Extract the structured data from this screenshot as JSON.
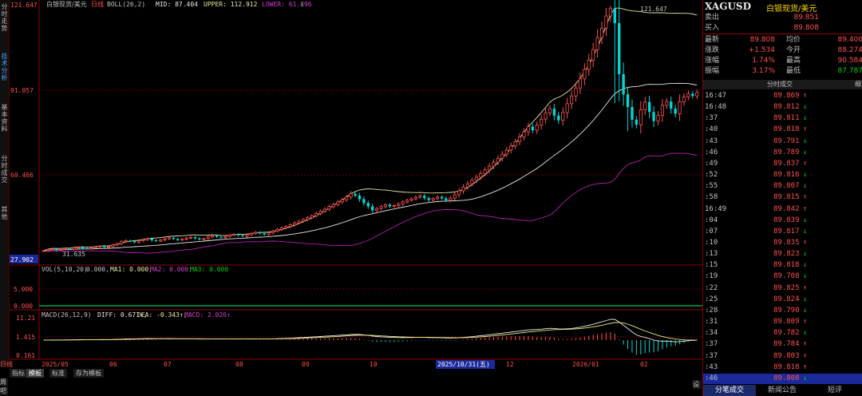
{
  "side_tabs": [
    "分时走势",
    "技术分析",
    "基本资料",
    "分时成交",
    "其他"
  ],
  "indicator_bars": {
    "main": {
      "title": "白银现货/美元",
      "period": "日线",
      "formula": "BOLL(26,2)",
      "mid": "MID: 87.404",
      "upper": "UPPER: 112.912",
      "lower": "LOWER: 61.896",
      "arrow": "↓"
    },
    "vol": {
      "name": "VOL(5,10,20)",
      "value": "0.000,",
      "ma1": "MA1: 0.000,",
      "ma2": "MA2: 0.000,",
      "ma3": "MA3: 0.000"
    },
    "macd": {
      "name": "MACD(26,12,9)",
      "diff": "DIFF: 0.671↑,",
      "dea": "DEA: -0.343↑,",
      "macd": "MACD: 2.026↑"
    }
  },
  "axis_labels": {
    "price_top": "121.647",
    "price_mid": "91.057",
    "price_low": "60.466",
    "price_bottom": "27.902",
    "vol_mid": "5.000",
    "vol_bottom": "0.000",
    "macd_top": "11.21",
    "macd_mid": "1.415",
    "macd_bottom": "0.161"
  },
  "chart_data": {
    "type": "candlestick",
    "title": "白银现货/美元 日线",
    "x_tick_labels": [
      "2025/05",
      "06",
      "07",
      "08",
      "09",
      "10",
      "2025/10/31(五)",
      "12",
      "2026/01",
      "02"
    ],
    "annotations": {
      "high": "121.647",
      "low": "31.635"
    },
    "y_axis": {
      "min": 27.902,
      "max": 121.647,
      "ticks": [
        121.647,
        91.057,
        60.466,
        27.902
      ]
    },
    "indicator": "BOLL(26,2)",
    "last_values": {
      "mid": 87.404,
      "upper": 112.912,
      "lower": 61.896
    },
    "close_series": [
      32.5,
      32.9,
      33.2,
      32.8,
      33.0,
      33.3,
      33.1,
      33.6,
      33.8,
      33.4,
      33.2,
      33.5,
      33.9,
      34.2,
      33.8,
      34.0,
      34.6,
      35.1,
      35.8,
      36.2,
      36.0,
      35.6,
      36.1,
      36.5,
      36.9,
      36.3,
      36.0,
      36.4,
      36.8,
      37.2,
      36.8,
      36.4,
      36.7,
      37.1,
      37.4,
      37.0,
      36.6,
      36.9,
      37.5,
      38.0,
      37.6,
      37.3,
      37.7,
      38.2,
      38.5,
      38.1,
      37.8,
      38.3,
      38.8,
      39.2,
      38.8,
      38.4,
      39.0,
      39.6,
      40.2,
      40.8,
      41.3,
      41.9,
      42.6,
      43.2,
      43.8,
      44.5,
      45.2,
      46.0,
      46.8,
      47.6,
      48.5,
      49.3,
      50.2,
      51.0,
      52.0,
      53.2,
      52.5,
      51.2,
      49.8,
      48.6,
      47.2,
      47.8,
      48.5,
      49.2,
      48.6,
      48.9,
      49.5,
      50.2,
      50.8,
      51.3,
      51.9,
      52.4,
      51.6,
      50.9,
      51.4,
      52.0,
      51.5,
      50.8,
      51.6,
      52.8,
      54.2,
      55.6,
      56.8,
      58.0,
      59.2,
      60.5,
      61.8,
      63.2,
      64.6,
      66.0,
      67.5,
      69.0,
      70.5,
      72.0,
      73.8,
      75.6,
      77.5,
      76.2,
      78.0,
      80.2,
      82.5,
      84.0,
      81.5,
      79.8,
      82.6,
      85.8,
      88.6,
      91.5,
      94.8,
      98.2,
      101.6,
      105.4,
      109.8,
      113.2,
      117.6,
      120.4,
      115.0,
      96.5,
      89.2,
      84.6,
      80.0,
      78.2,
      83.6,
      86.4,
      82.8,
      79.5,
      81.6,
      85.2,
      86.6,
      84.0,
      82.2,
      86.5,
      88.2,
      89.4,
      88.6,
      89.8
    ],
    "macd_labels": {
      "diff": 0.671,
      "dea": -0.343,
      "macd": 2.026
    }
  },
  "quote_panel": {
    "symbol": "XAGUSD",
    "name": "白银现货/美元",
    "ask_label": "卖出",
    "ask_value": "89.851",
    "bid_label": "买入",
    "bid_value": "89.808",
    "rows": [
      {
        "l1": "最新",
        "v1": "89.808",
        "c1": "up",
        "l2": "均价",
        "v2": "89.400",
        "c2": "up"
      },
      {
        "l1": "涨跌",
        "v1": "+1.534",
        "c1": "up",
        "l2": "今开",
        "v2": "88.274",
        "c2": "up"
      },
      {
        "l1": "涨幅",
        "v1": "1.74%",
        "c1": "up",
        "l2": "最高",
        "v2": "90.584",
        "c2": "up"
      },
      {
        "l1": "振幅",
        "v1": "3.17%",
        "c1": "up",
        "l2": "最低",
        "v2": "87.787",
        "c2": "dn"
      }
    ],
    "ticks_header": "分时成交",
    "ticks_header_right": "细",
    "ticks": [
      {
        "t": "16:47",
        "p": "89.869",
        "a": "↑",
        "c": "up"
      },
      {
        "t": "16:48",
        "p": "89.812",
        "a": "↓",
        "c": "dn"
      },
      {
        "t": ":37",
        "p": "89.811",
        "a": "↓",
        "c": "dn"
      },
      {
        "t": ":40",
        "p": "89.818",
        "a": "↑",
        "c": "up"
      },
      {
        "t": ":43",
        "p": "89.791",
        "a": "↓",
        "c": "dn"
      },
      {
        "t": ":46",
        "p": "89.789",
        "a": "↓",
        "c": "dn"
      },
      {
        "t": ":49",
        "p": "89.837",
        "a": "↑",
        "c": "up"
      },
      {
        "t": ":52",
        "p": "89.816",
        "a": "↓",
        "c": "dn"
      },
      {
        "t": ":55",
        "p": "89.807",
        "a": "↓",
        "c": "dn"
      },
      {
        "t": ":58",
        "p": "89.815",
        "a": "↑",
        "c": "up"
      },
      {
        "t": "16:49",
        "p": "89.842",
        "a": "↑",
        "c": "up"
      },
      {
        "t": ":04",
        "p": "89.839",
        "a": "↓",
        "c": "dn"
      },
      {
        "t": ":07",
        "p": "89.817",
        "a": "↓",
        "c": "dn"
      },
      {
        "t": ":10",
        "p": "89.835",
        "a": "↑",
        "c": "up"
      },
      {
        "t": ":13",
        "p": "89.823",
        "a": "↓",
        "c": "dn"
      },
      {
        "t": ":15",
        "p": "89.818",
        "a": "↓",
        "c": "dn"
      },
      {
        "t": ":19",
        "p": "89.708",
        "a": "↓",
        "c": "dn"
      },
      {
        "t": ":22",
        "p": "89.825",
        "a": "↑",
        "c": "up"
      },
      {
        "t": ":25",
        "p": "89.824",
        "a": "↓",
        "c": "dn"
      },
      {
        "t": ":28",
        "p": "89.790",
        "a": "↓",
        "c": "dn"
      },
      {
        "t": ":31",
        "p": "89.809",
        "a": "↑",
        "c": "up"
      },
      {
        "t": ":34",
        "p": "89.782",
        "a": "↓",
        "c": "dn"
      },
      {
        "t": ":37",
        "p": "89.784",
        "a": "↑",
        "c": "up"
      },
      {
        "t": ":37",
        "p": "89.803",
        "a": "↑",
        "c": "up"
      },
      {
        "t": ":43",
        "p": "89.818",
        "a": "↑",
        "c": "up"
      },
      {
        "t": ":46",
        "p": "89.808",
        "a": "↓",
        "c": "dn"
      }
    ],
    "bottom_tabs": [
      "分笔成交",
      "新闻公告",
      "短评"
    ]
  },
  "bottom_tabs": [
    "指标",
    "模板",
    "标准",
    "存为模板"
  ],
  "bottom_left_labels": [
    "日线",
    "周",
    "吧"
  ],
  "bottom_right_label": "设",
  "colors": {
    "up": "#ff5050",
    "down": "#00d8d8",
    "boll_mid": "#e8e8e8",
    "boll_upper": "#e8e8a0",
    "boll_lower": "#b020b0",
    "grid": "#6a0000"
  }
}
